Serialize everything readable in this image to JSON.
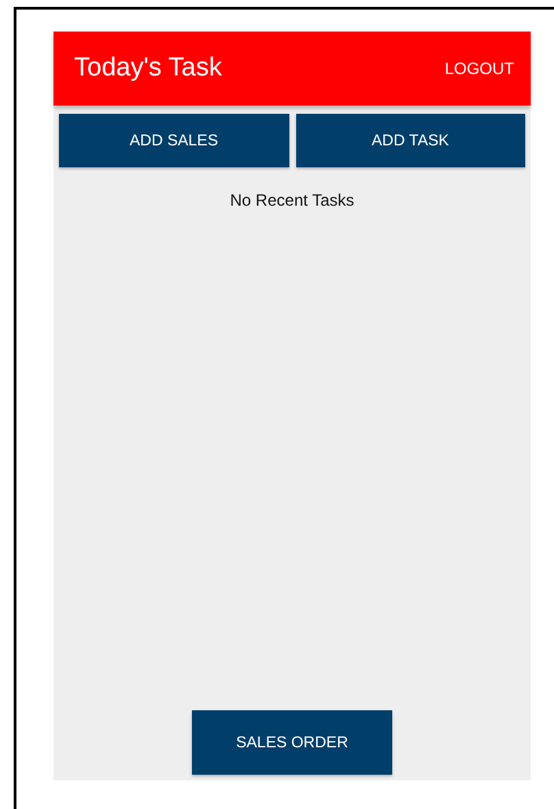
{
  "app_bar": {
    "title": "Today's Task",
    "action": "LOGOUT"
  },
  "top_buttons": [
    "ADD SALES",
    "ADD TASK"
  ],
  "empty_message": "No Recent Tasks",
  "bottom_button": "SALES ORDER"
}
